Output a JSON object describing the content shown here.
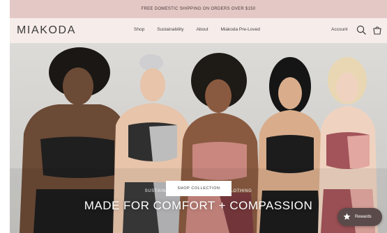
{
  "announcement": {
    "text": "FREE DOMESTIC SHIPPING ON ORDERS OVER $150"
  },
  "header": {
    "logo": "MIAKODA",
    "nav": [
      "Shop",
      "Sustainability",
      "About",
      "Miakoda Pre-Loved"
    ],
    "account_label": "Account",
    "search_icon": "search-icon",
    "cart_icon": "cart-icon"
  },
  "hero": {
    "kicker": "SUSTAINABLE + ETHICALLY MADE CLOTHING",
    "title": "MADE FOR COMFORT + COMPASSION",
    "cta_label": "SHOP COLLECTION"
  },
  "rewards": {
    "label": "Rewards",
    "icon": "star-icon"
  },
  "colors": {
    "announcement_bg": "#e3c8c6",
    "header_bg": "#f6ecea",
    "hero_bg": "#d3d2cf",
    "rewards_bg": "#5b4a4a"
  }
}
